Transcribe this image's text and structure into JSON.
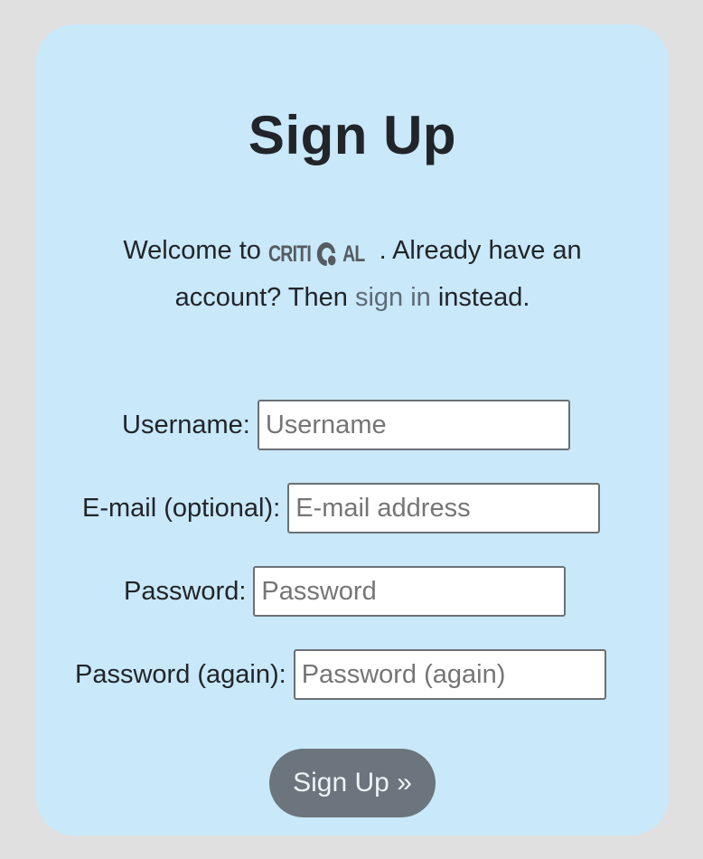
{
  "page": {
    "title": "Sign Up",
    "intro": {
      "welcome_prefix": "Welcome to ",
      "brand_name_part1": "CRITI",
      "brand_name_part2": "AL",
      "text_after_brand": ". Already have an account? Then ",
      "signin_link": "sign in",
      "text_after_link": " instead."
    }
  },
  "form": {
    "fields": [
      {
        "label": "Username:",
        "placeholder": "Username",
        "value": ""
      },
      {
        "label": "E-mail (optional):",
        "placeholder": "E-mail address",
        "value": ""
      },
      {
        "label": "Password:",
        "placeholder": "Password",
        "value": ""
      },
      {
        "label": "Password (again):",
        "placeholder": "Password (again)",
        "value": ""
      }
    ],
    "submit_label": "Sign Up »"
  },
  "icons": {
    "logo_mark": "circular-c-logo-icon"
  },
  "colors": {
    "page_background": "#e0e0e0",
    "card_background": "#c9e8fa",
    "button_background": "#6c757d",
    "link": "#5d6b75"
  }
}
